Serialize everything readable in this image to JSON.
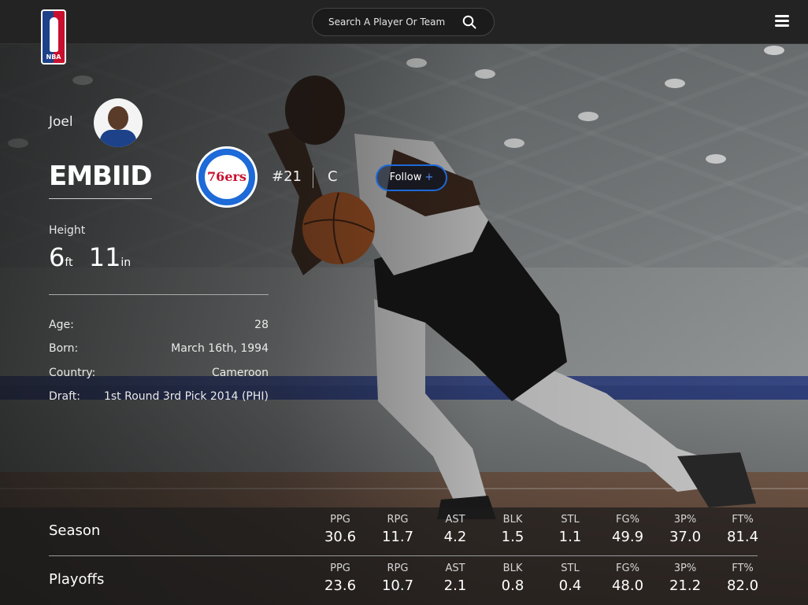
{
  "header": {
    "logo_text": "NBA",
    "search_placeholder": "Search A Player Or Team"
  },
  "player": {
    "first_name": "Joel",
    "last_name": "EMBIID",
    "team_logo_text": "76ers",
    "jersey": "#21",
    "position": "C",
    "follow_label": "Follow",
    "follow_plus": "+",
    "height_label": "Height",
    "height_ft": "6",
    "height_ft_unit": "ft",
    "height_in": "11",
    "height_in_unit": "in",
    "details": [
      {
        "key": "Age:",
        "value": "28"
      },
      {
        "key": "Born:",
        "value": "March 16th, 1994"
      },
      {
        "key": "Country:",
        "value": "Cameroon"
      },
      {
        "key": "Draft:",
        "value": "1st Round 3rd Pick 2014 (PHI)"
      }
    ]
  },
  "stats": {
    "headers": [
      "PPG",
      "RPG",
      "AST",
      "BLK",
      "STL",
      "FG%",
      "3P%",
      "FT%"
    ],
    "rows": [
      {
        "label": "Season",
        "values": [
          "30.6",
          "11.7",
          "4.2",
          "1.5",
          "1.1",
          "49.9",
          "37.0",
          "81.4"
        ]
      },
      {
        "label": "Playoffs",
        "values": [
          "23.6",
          "10.7",
          "2.1",
          "0.8",
          "0.4",
          "48.0",
          "21.2",
          "82.0"
        ]
      }
    ]
  },
  "colors": {
    "accent": "#1d6ad8",
    "header_bg": "#232323",
    "team_red": "#c8102e"
  }
}
